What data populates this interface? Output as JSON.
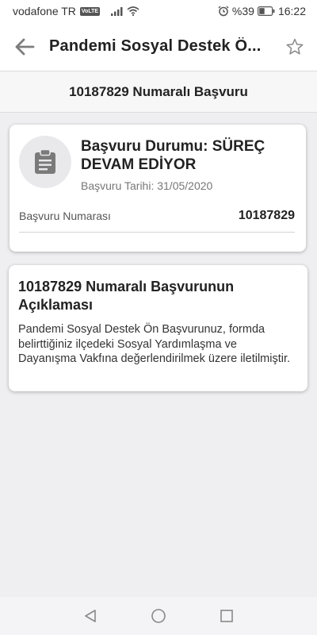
{
  "status_bar": {
    "carrier": "vodafone TR",
    "volte": "VoLTE",
    "battery": "%39",
    "time": "16:22"
  },
  "app_bar": {
    "title": "Pandemi Sosyal Destek Ö...",
    "back_icon": "arrow-left-icon",
    "star_icon": "star-outline-icon"
  },
  "sub_header": {
    "title": "10187829 Numaralı Başvuru"
  },
  "status_card": {
    "icon": "clipboard-icon",
    "status_title": "Başvuru Durumu: SÜREÇ DEVAM EDİYOR",
    "date_text": "Başvuru Tarihi: 31/05/2020",
    "application_no_label": "Başvuru Numarası",
    "application_no_value": "10187829"
  },
  "description_card": {
    "title": "10187829 Numaralı Başvurunun Açıklaması",
    "body": "Pandemi Sosyal Destek Ön Başvurunuz, formda belirttiğiniz ilçedeki Sosyal Yardımlaşma ve Dayanışma Vakfına değerlendirilmek üzere iletilmiştir."
  },
  "nav_bar": {
    "back_icon": "nav-back-triangle-icon",
    "home_icon": "nav-home-circle-icon",
    "recents_icon": "nav-recents-square-icon"
  },
  "colors": {
    "background": "#efeff2",
    "card": "#ffffff",
    "icon_circle": "#e9e9ec",
    "icon_gray": "#7a7a7a"
  }
}
